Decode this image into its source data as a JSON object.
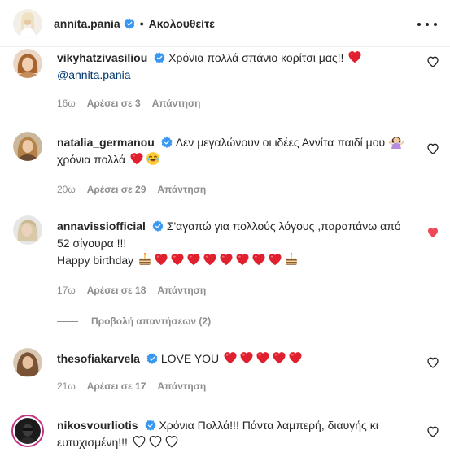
{
  "header": {
    "username": "annita.pania",
    "separator": "•",
    "follow_label": "Ακολουθείτε"
  },
  "comments": [
    {
      "username": "vikyhatzivasiliou",
      "text": "Χρόνια πολλά σπάνιο κορίτσι μας!!",
      "mention": "@annita.pania",
      "time": "16ω",
      "likes": "Αρέσει σε 3",
      "reply": "Απάντηση",
      "liked": false
    },
    {
      "username": "natalia_germanou",
      "text": "Δεν μεγαλώνουν οι ιδέες Αννίτα παιδί μου",
      "text2": "χρόνια πολλά",
      "time": "20ω",
      "likes": "Αρέσει σε 29",
      "reply": "Απάντηση",
      "liked": false
    },
    {
      "username": "annavissiofficial",
      "text": "Σ'αγαπώ για πολλούς λόγους ,παραπάνω από 52 σίγουρα !!!",
      "text2": "Happy birthday",
      "time": "17ω",
      "likes": "Αρέσει σε 18",
      "reply": "Απάντηση",
      "liked": true,
      "view_replies": "Προβολή απαντήσεων (2)"
    },
    {
      "username": "thesofiakarvela",
      "text": "LOVE YOU",
      "time": "21ω",
      "likes": "Αρέσει σε 17",
      "reply": "Απάντηση",
      "liked": false
    },
    {
      "username": "nikosvourliotis",
      "text": "Χρόνια Πολλά!!! Πάντα λαμπερή, διαυγής κι ευτυχισμένη!!!",
      "liked": false
    }
  ],
  "colors": {
    "verified": "#3897f0",
    "liked_heart": "#ed4956",
    "emoji_heart": "#e0202e",
    "meta_text": "#8e8e8e"
  }
}
